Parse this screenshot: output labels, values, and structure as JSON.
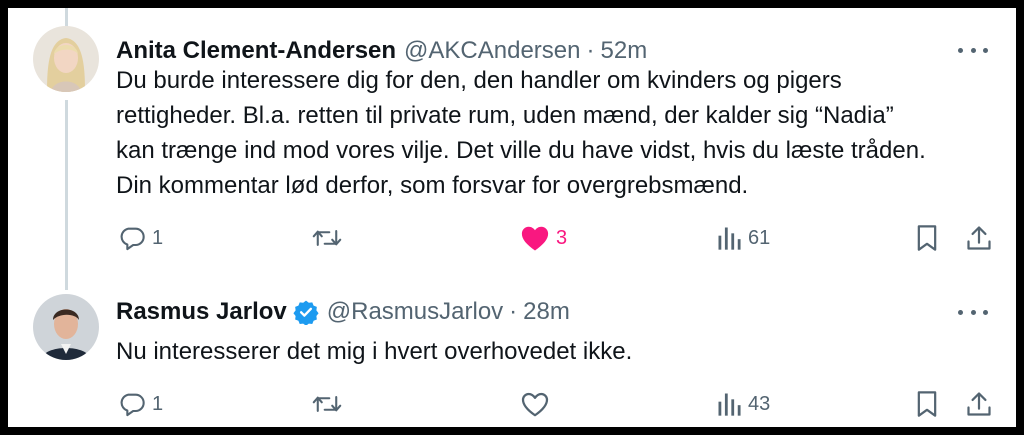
{
  "tweets": [
    {
      "author_name": "Anita Clement-Andersen",
      "handle": "@AKCAndersen",
      "separator": "·",
      "time": "52m",
      "verified": false,
      "lines": [
        "Du burde interessere dig for den, den handler om kvinders og pigers",
        "rettigheder. Bl.a. retten til private rum, uden mænd, der kalder sig “Nadia”",
        "kan trænge ind mod vores vilje. Det ville du have vidst, hvis du læste tråden.",
        "Din kommentar lød derfor, som forsvar for overgrebsmænd."
      ],
      "reply_count": "1",
      "retweet_count": "",
      "like_count": "3",
      "liked": true,
      "views_count": "61"
    },
    {
      "author_name": "Rasmus Jarlov",
      "handle": "@RasmusJarlov",
      "separator": "·",
      "time": "28m",
      "verified": true,
      "lines": [
        "Nu interesserer det mig i hvert overhovedet ikke."
      ],
      "reply_count": "1",
      "retweet_count": "",
      "like_count": "",
      "liked": false,
      "views_count": "43"
    }
  ],
  "colors": {
    "text": "#0f1419",
    "secondary": "#536471",
    "like": "#f91880",
    "verified": "#1d9bf0",
    "thread_line": "#cfd9de"
  },
  "icons": {
    "reply": "reply-icon",
    "retweet": "retweet-icon",
    "like": "heart-icon",
    "views": "views-icon",
    "bookmark": "bookmark-icon",
    "share": "share-icon",
    "more": "more-icon",
    "verified": "verified-badge-icon"
  }
}
